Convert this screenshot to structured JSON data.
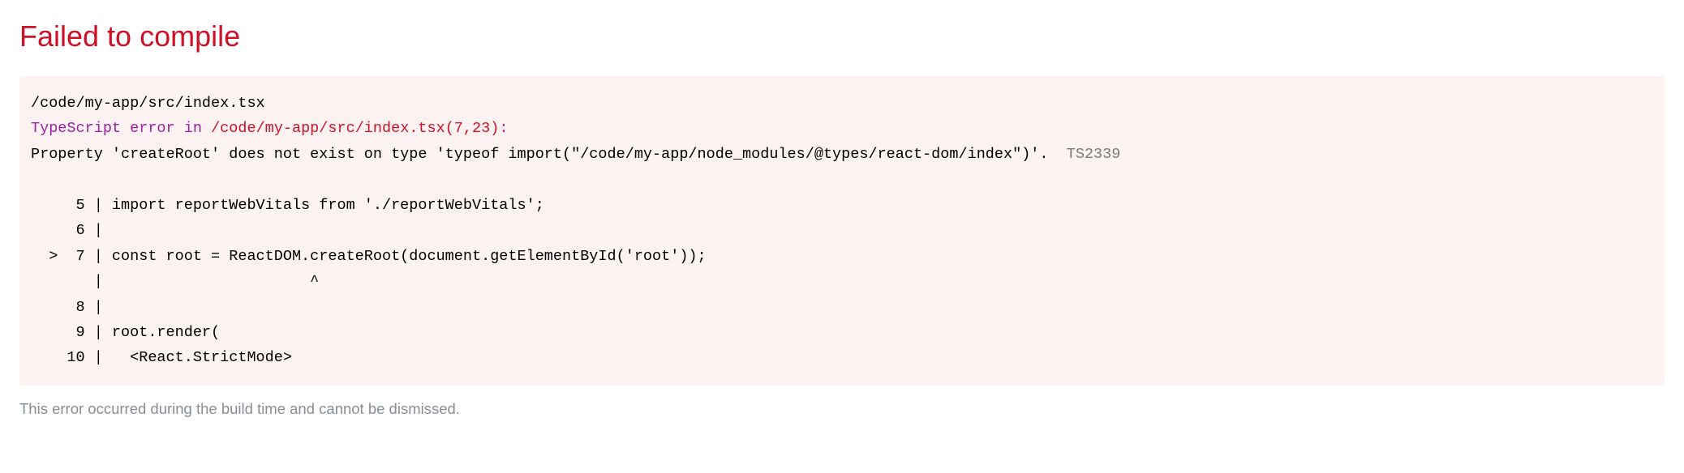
{
  "title": "Failed to compile",
  "error": {
    "file_path": "/code/my-app/src/index.tsx",
    "ts_error_label": "TypeScript error",
    "ts_error_in": " in ",
    "ts_error_location": "/code/my-app/src/index.tsx(7,23)",
    "ts_error_colon": ":",
    "message": "Property 'createRoot' does not exist on type 'typeof import(\"/code/my-app/node_modules/@types/react-dom/index\")'.  ",
    "code": "TS2339",
    "snippet": {
      "line5": "     5 | import reportWebVitals from './reportWebVitals';",
      "line6": "     6 | ",
      "line7": "  >  7 | const root = ReactDOM.createRoot(document.getElementById('root'));",
      "caret": "       |                       ^",
      "line8": "     8 | ",
      "line9": "     9 | root.render(",
      "line10": "    10 |   <React.StrictMode>"
    }
  },
  "footer": "This error occurred during the build time and cannot be dismissed."
}
